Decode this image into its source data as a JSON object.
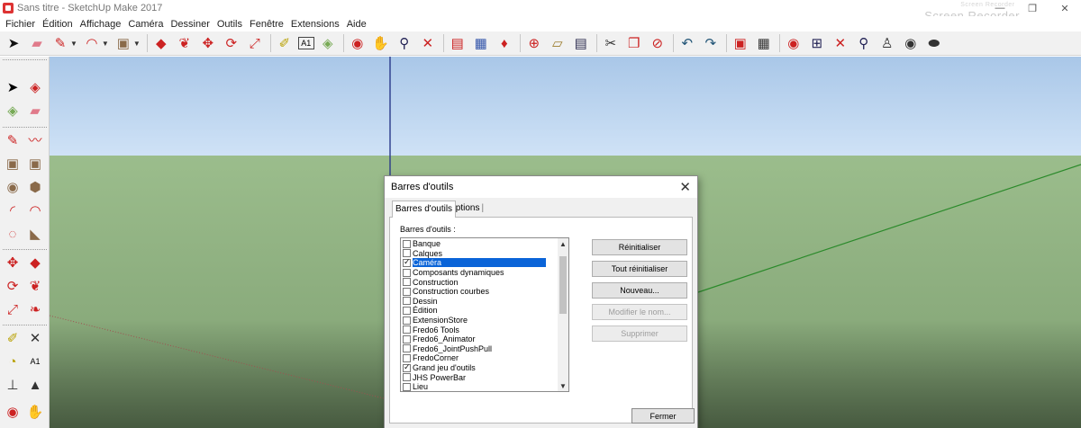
{
  "window": {
    "title": "Sans titre - SketchUp Make 2017",
    "buttons": [
      "—",
      "❐",
      "✕"
    ],
    "watermark_small": "Screen Recorder",
    "watermark": "Screen Recorder"
  },
  "menu": [
    "Fichier",
    "Édition",
    "Affichage",
    "Caméra",
    "Dessiner",
    "Outils",
    "Fenêtre",
    "Extensions",
    "Aide"
  ],
  "toolbar_top_icons": [
    "select-icon",
    "eraser-icon",
    "pencil-icon",
    "arc-icon",
    "rectangle-icon",
    "push-pull-icon",
    "follow-me-icon",
    "move-icon",
    "rotate-icon",
    "scale-icon",
    "tape-measure-icon",
    "text-icon",
    "paint-bucket-icon",
    "orbit-icon",
    "pan-icon",
    "zoom-icon",
    "zoom-extents-icon",
    "warehouse-icon",
    "share-icon",
    "extension-icon",
    "add-component-icon",
    "open-icon",
    "save-icon",
    "cut-icon",
    "copy-icon",
    "erase-icon",
    "undo-icon",
    "redo-icon",
    "print-icon",
    "model-info-icon",
    "section-icon",
    "zoom-window-icon",
    "zoom-extents-icon-2",
    "previous-view-icon",
    "position-camera-icon",
    "look-around-icon",
    "walk-icon"
  ],
  "dialog": {
    "title": "Barres d'outils",
    "close": "✕",
    "tabs": [
      "Barres d'outils",
      "Options"
    ],
    "list_label": "Barres d'outils :",
    "items": [
      {
        "label": "Banque",
        "checked": false
      },
      {
        "label": "Calques",
        "checked": false
      },
      {
        "label": "Caméra",
        "checked": true,
        "selected": true
      },
      {
        "label": "Composants dynamiques",
        "checked": false
      },
      {
        "label": "Construction",
        "checked": false
      },
      {
        "label": "Construction courbes",
        "checked": false
      },
      {
        "label": "Dessin",
        "checked": false
      },
      {
        "label": "Édition",
        "checked": false
      },
      {
        "label": "ExtensionStore",
        "checked": false
      },
      {
        "label": "Fredo6 Tools",
        "checked": false
      },
      {
        "label": "Fredo6_Animator",
        "checked": false
      },
      {
        "label": "Fredo6_JointPushPull",
        "checked": false
      },
      {
        "label": "FredoCorner",
        "checked": false
      },
      {
        "label": "Grand jeu d'outils",
        "checked": true
      },
      {
        "label": "JHS PowerBar",
        "checked": false
      },
      {
        "label": "Lieu",
        "checked": false
      }
    ],
    "buttons": {
      "reset": "Réinitialiser",
      "reset_all": "Tout réinitialiser",
      "new": "Nouveau...",
      "rename": "Modifier le nom...",
      "delete": "Supprimer",
      "close": "Fermer"
    }
  }
}
